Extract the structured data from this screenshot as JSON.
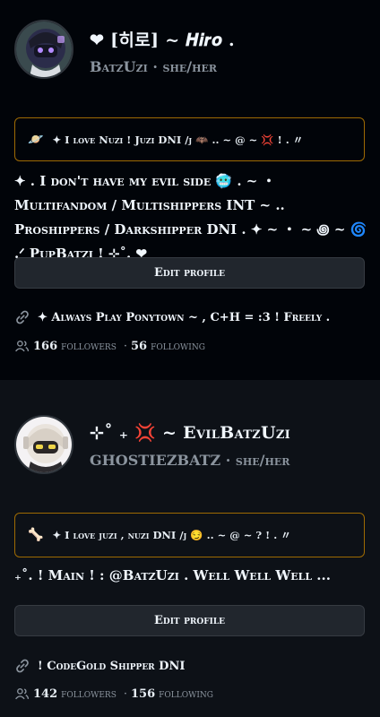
{
  "profiles": [
    {
      "title": "❤︎ [히로] ~ 𝑯𝒊𝒓𝒐 .",
      "username": "BatzUzi",
      "pronouns": "she/her",
      "status_emoji": "🪐",
      "status_text": "✦ I love Nuzi ! Juzi DNI /j 🦇 .. ~ @ ~ 💢 ! . 〃",
      "bio": "✦ . I don't have my evil side 🥶 . ~ ・ Multifandom / Multishippers INT ~ .. Proshippers / Darkshipper DNI . ✦ ~ ・ ~ ꩜ ~ 🌀 .ᐟ PupBatzi ! ⊹˚. ❤︎",
      "edit_label": "Edit profile",
      "link_text": "✦ Always Play Ponytown ~ , C+H = :3 ! Freely .",
      "followers_count": "166",
      "followers_label": "followers",
      "following_count": "56",
      "following_label": "following",
      "avatar_colors": {
        "bg": "#3a4a4e",
        "hair": "#2b2c4a",
        "visor": "#1b1c2a"
      }
    },
    {
      "title": "⊹˚ ₊ 💢 ~ EvilBatzUzi",
      "username": "GHOSTIEZBATZ",
      "pronouns": "she/her",
      "status_emoji": "🦴",
      "status_text": "✦ I love juzi , nuzi DNI /j 😏 .. ~ @ ~ ? ! . 〃",
      "bio": "₊˚. ! Main ! : @BatzUzi . Well Well Well ...",
      "edit_label": "Edit profile",
      "link_text": "! CodeGold Shipper DNI",
      "followers_count": "142",
      "followers_label": "followers",
      "following_count": "156",
      "following_label": "following",
      "avatar_colors": {
        "bg": "#f4f2f4",
        "hair": "#e9e3dc",
        "visor": "#f0d64a"
      }
    }
  ],
  "colors": {
    "status_border": "#9e6a03",
    "muted": "#8b949e",
    "button_bg": "#21262d"
  }
}
